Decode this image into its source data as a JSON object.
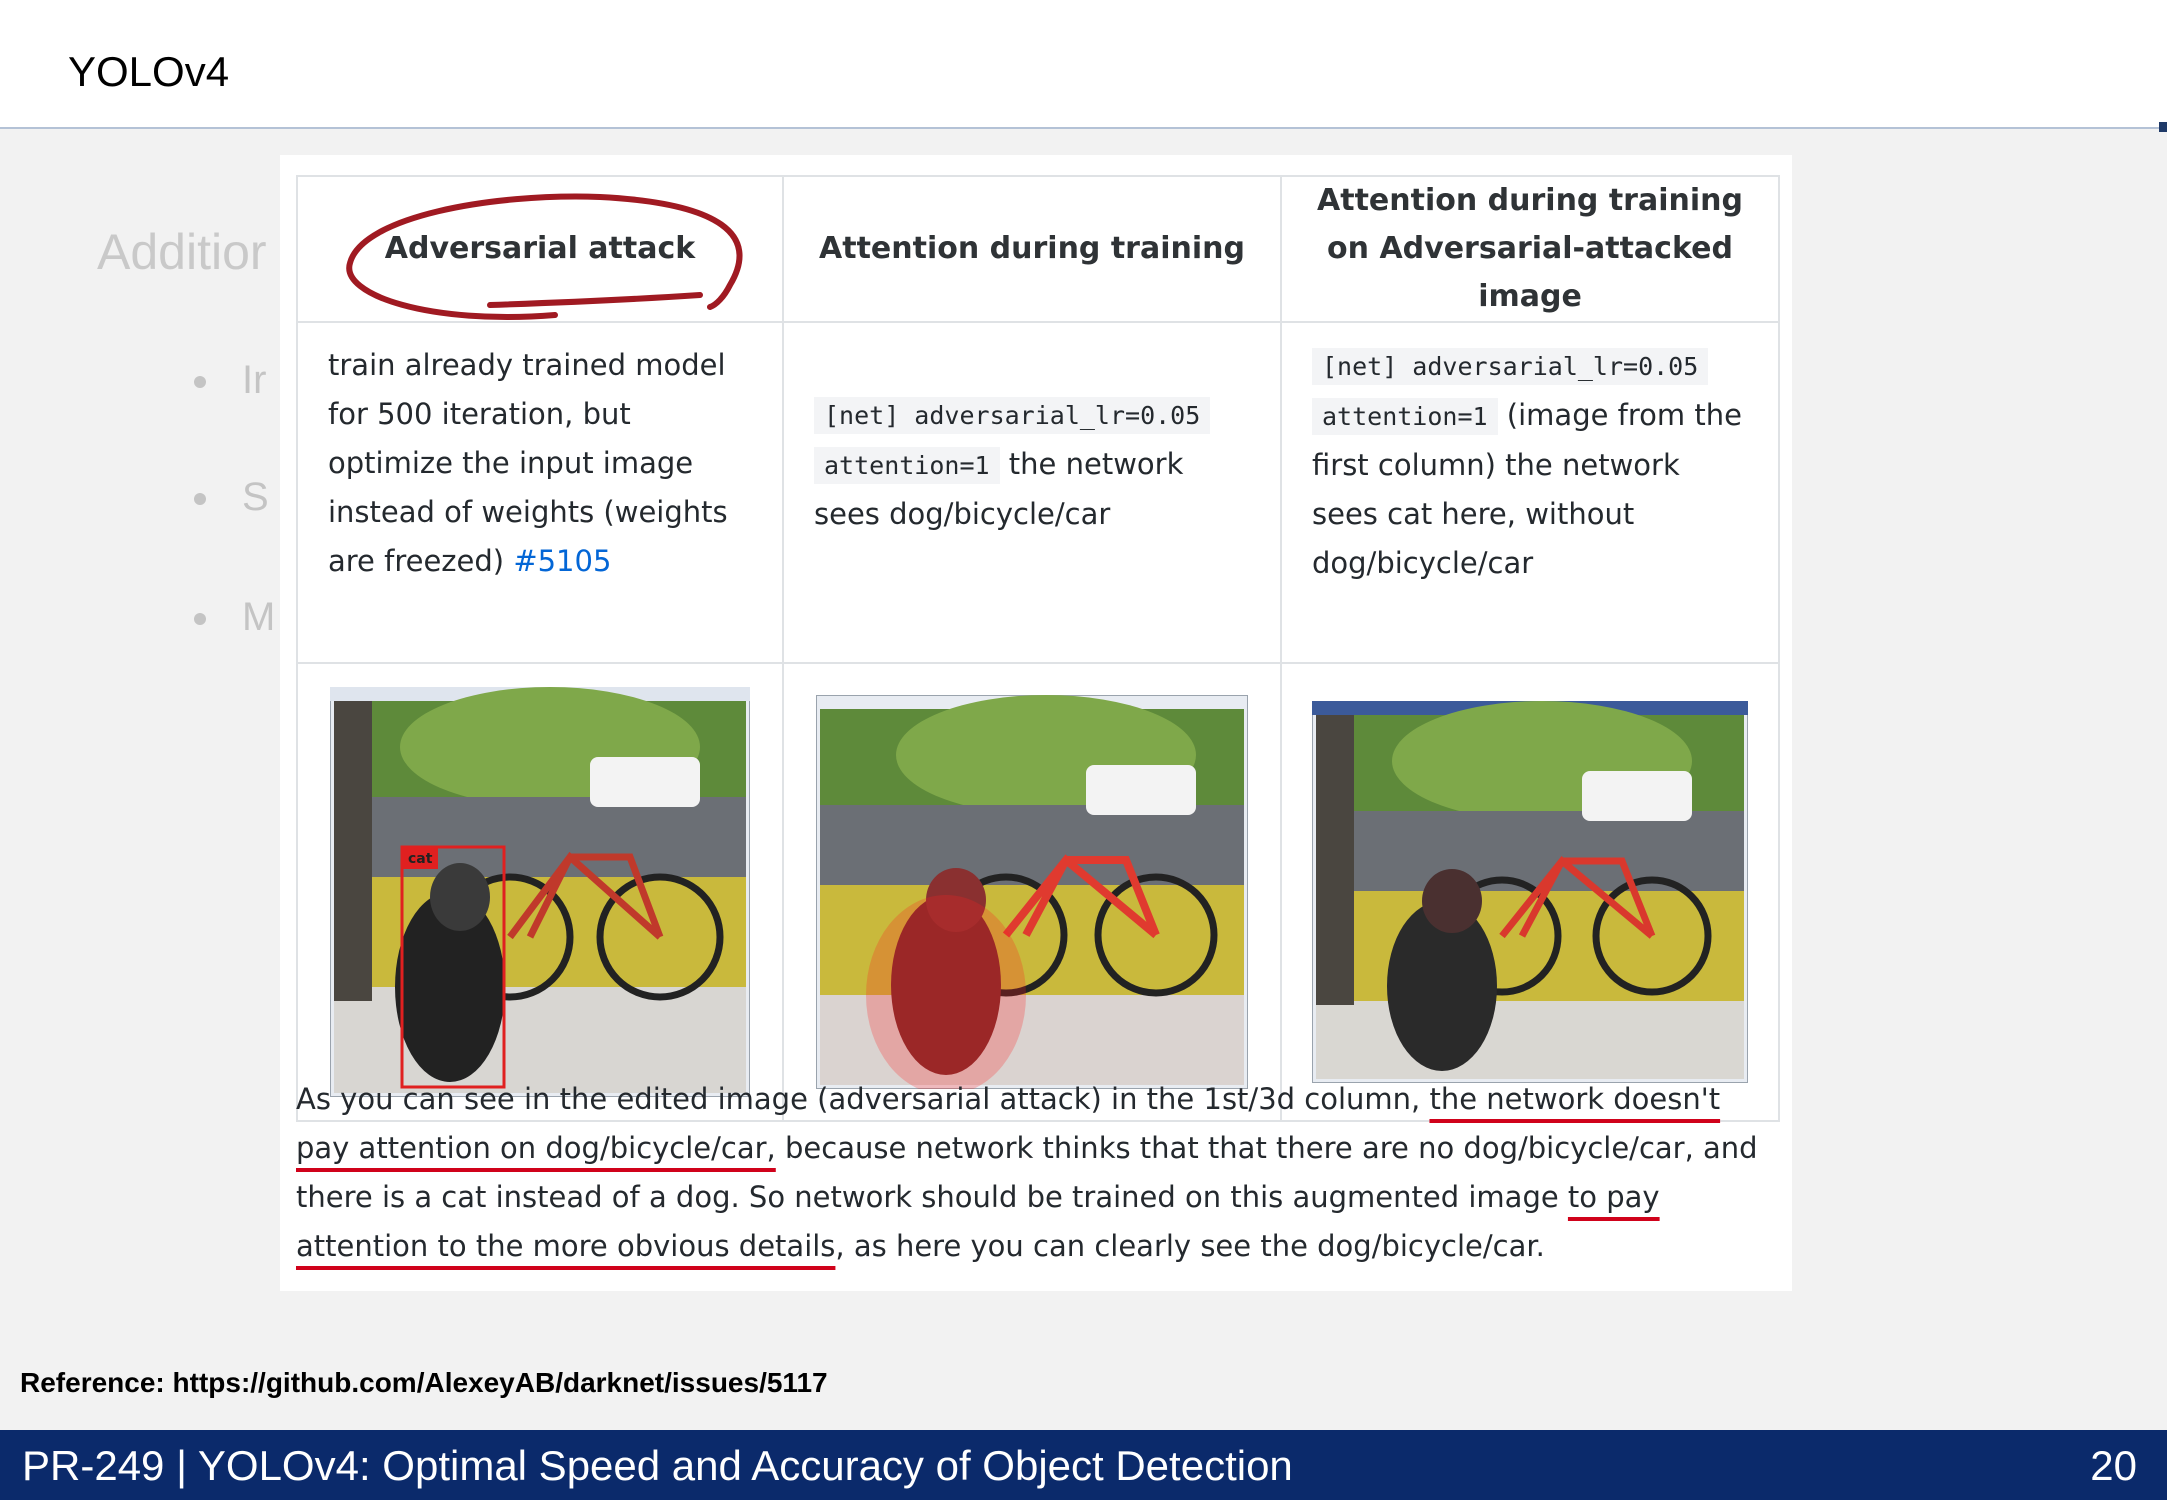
{
  "slide": {
    "title": "YOLOv4",
    "background_heading": "Additior",
    "background_bullets": [
      "Ir",
      "S",
      "M"
    ]
  },
  "table": {
    "headers": [
      "Adversarial attack",
      "Attention during training",
      "Attention during training on Adversarial-attacked image"
    ],
    "col1": {
      "text": "train already trained model for 500 iteration, but optimize the input image instead of weights (weights are freezed)",
      "link": "#5105"
    },
    "col2": {
      "code1": "[net] adversarial_lr=0.05",
      "code2": "attention=1",
      "text": "the network sees dog/bicycle/car"
    },
    "col3": {
      "code1": "[net] adversarial_lr=0.05",
      "code2": "attention=1",
      "text": "(image from the first column) the network sees cat here, without dog/bicycle/car"
    },
    "detection_label": "cat"
  },
  "paragraph": {
    "p1": "As you can see in the edited image (adversarial attack) in the 1st/3d column, ",
    "u1": "the network doesn't pay attention on dog/bicycle/car,",
    "p2": " because network thinks that that there are no dog/bicycle/car, and there is a cat instead of a dog. So network should be trained on this augmented image ",
    "u2": "to pay attention to the more obvious details",
    "p3": ", as here you can clearly see the dog/bicycle/car."
  },
  "reference": "Reference: https://github.com/AlexeyAB/darknet/issues/5117",
  "footer": {
    "text": "PR-249 | YOLOv4: Optimal Speed and Accuracy of Object Detection",
    "page_number": "20"
  },
  "colors": {
    "footer_bg": "#0b2a6b",
    "annotation_red": "#d0021b",
    "link_blue": "#0366d6"
  }
}
